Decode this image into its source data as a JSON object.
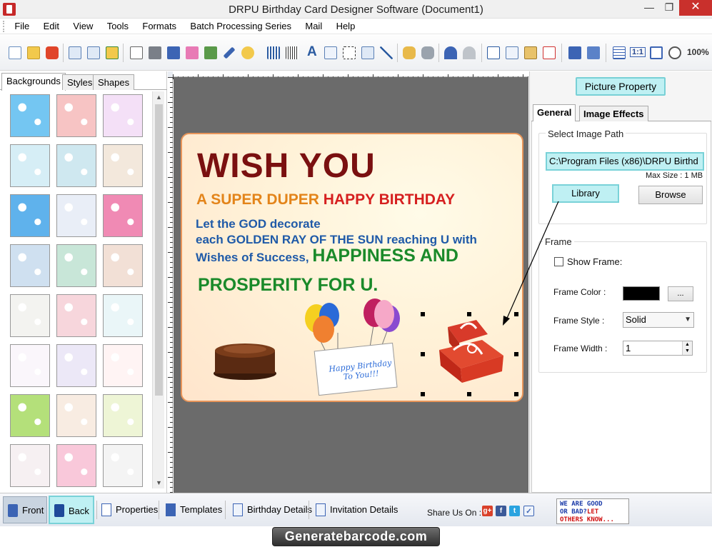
{
  "window": {
    "title": "DRPU Birthday Card Designer Software (Document1)"
  },
  "menu": [
    "File",
    "Edit",
    "View",
    "Tools",
    "Formats",
    "Batch Processing Series",
    "Mail",
    "Help"
  ],
  "toolbar": {
    "zoom_label": "100%",
    "one_to_one": "1:1"
  },
  "left_panel": {
    "tabs": [
      "Backgrounds",
      "Styles",
      "Shapes"
    ],
    "active_tab": "Backgrounds",
    "thumbnail_colors": [
      [
        "#74c6f2",
        "#f7c4c4",
        "#f4e0f7"
      ],
      [
        "#d6eef6",
        "#cfe8f0",
        "#f3e8dc"
      ],
      [
        "#5fb2ec",
        "#e9eef7",
        "#f08ab4"
      ],
      [
        "#cfe0f0",
        "#c8e6d8",
        "#f2e0d6"
      ],
      [
        "#f3f3f0",
        "#f7d6dc",
        "#eaf6f8"
      ],
      [
        "#faf6fb",
        "#ece8f7",
        "#fff4f4"
      ],
      [
        "#b4e07a",
        "#f8ece2",
        "#eef5d6"
      ],
      [
        "#f6f0f2",
        "#f9c8da",
        "#f4f4f4"
      ]
    ]
  },
  "card": {
    "line1": "WISH YOU",
    "line2a": "A SUPER DUPER",
    "line2b": "HAPPY BIRTHDAY",
    "line3a": "Let the GOD decorate",
    "line3b": "each GOLDEN RAY OF THE SUN reaching U with",
    "line3c": "Wishes of Success,",
    "line3d": "HAPPINESS AND",
    "line4": "PROSPERITY FOR U.",
    "tag_line1": "Happy Birthday",
    "tag_line2": "To You!!!"
  },
  "right_panel": {
    "picture_property": "Picture Property",
    "tabs": [
      "General",
      "Image Effects"
    ],
    "active_tab": "General",
    "select_image_path_label": "Select Image Path",
    "image_path": "C:\\Program Files (x86)\\DRPU Birthd",
    "max_size": "Max Size : 1 MB",
    "library_button": "Library",
    "browse_button": "Browse",
    "frame_label": "Frame",
    "show_frame_label": "Show Frame:",
    "show_frame_checked": false,
    "frame_color_label": "Frame Color :",
    "frame_color": "#000000",
    "frame_color_button": "...",
    "frame_style_label": "Frame Style :",
    "frame_style_value": "Solid",
    "frame_width_label": "Frame Width :",
    "frame_width_value": "1"
  },
  "bottom_bar": {
    "front": "Front",
    "back": "Back",
    "properties": "Properties",
    "templates": "Templates",
    "birthday_details": "Birthday Details",
    "invitation_details": "Invitation Details",
    "share_label": "Share Us On :",
    "feedback_line1": "WE ARE GOOD",
    "feedback_line2a": "OR BAD?",
    "feedback_line2b": "LET",
    "feedback_line3": "OTHERS KNOW..."
  },
  "footer": {
    "brand": "Generatebarcode.com"
  }
}
